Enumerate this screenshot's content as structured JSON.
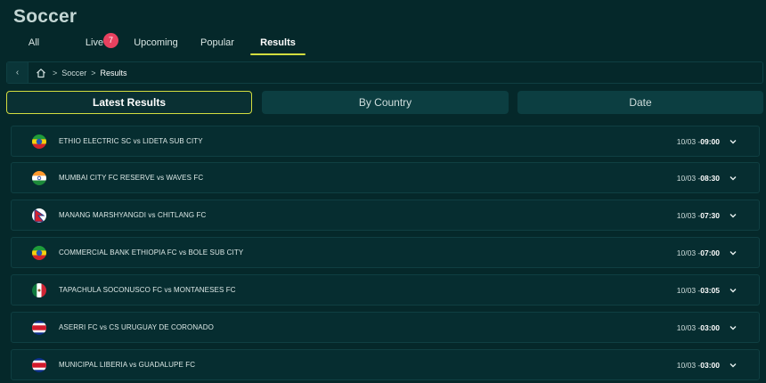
{
  "page_title": "Soccer",
  "tabs": [
    {
      "label": "All"
    },
    {
      "label": "Live",
      "badge": "7"
    },
    {
      "label": "Upcoming"
    },
    {
      "label": "Popular"
    },
    {
      "label": "Results",
      "active": true
    }
  ],
  "breadcrumb": {
    "items": [
      "Soccer",
      "Results"
    ]
  },
  "segments": [
    {
      "label": "Latest Results",
      "active": true
    },
    {
      "label": "By Country"
    },
    {
      "label": "Date"
    }
  ],
  "matches": [
    {
      "flag": "ethiopia-flag-icon",
      "name": "ETHIO ELECTRIC SC vs LIDETA SUB CITY",
      "date": "10/03 -",
      "time": "09:00"
    },
    {
      "flag": "india-flag-icon",
      "name": "MUMBAI CITY FC RESERVE vs WAVES FC",
      "date": "10/03 -",
      "time": "08:30"
    },
    {
      "flag": "nepal-flag-icon",
      "name": "MANANG MARSHYANGDI vs CHITLANG FC",
      "date": "10/03 -",
      "time": "07:30"
    },
    {
      "flag": "ethiopia-flag-icon",
      "name": "COMMERCIAL BANK ETHIOPIA FC vs BOLE SUB CITY",
      "date": "10/03 -",
      "time": "07:00"
    },
    {
      "flag": "mexico-flag-icon",
      "name": "TAPACHULA SOCONUSCO FC vs MONTANESES FC",
      "date": "10/03 -",
      "time": "03:05"
    },
    {
      "flag": "costa-rica-flag-icon",
      "name": "ASERRI FC vs CS URUGUAY DE CORONADO",
      "date": "10/03 -",
      "time": "03:00"
    },
    {
      "flag": "costa-rica-flag-icon",
      "name": "MUNICIPAL LIBERIA vs GUADALUPE FC",
      "date": "10/03 -",
      "time": "03:00"
    }
  ],
  "colors": {
    "accent": "#d3dd3f",
    "badge": "#e8415f",
    "background": "#05282a"
  }
}
